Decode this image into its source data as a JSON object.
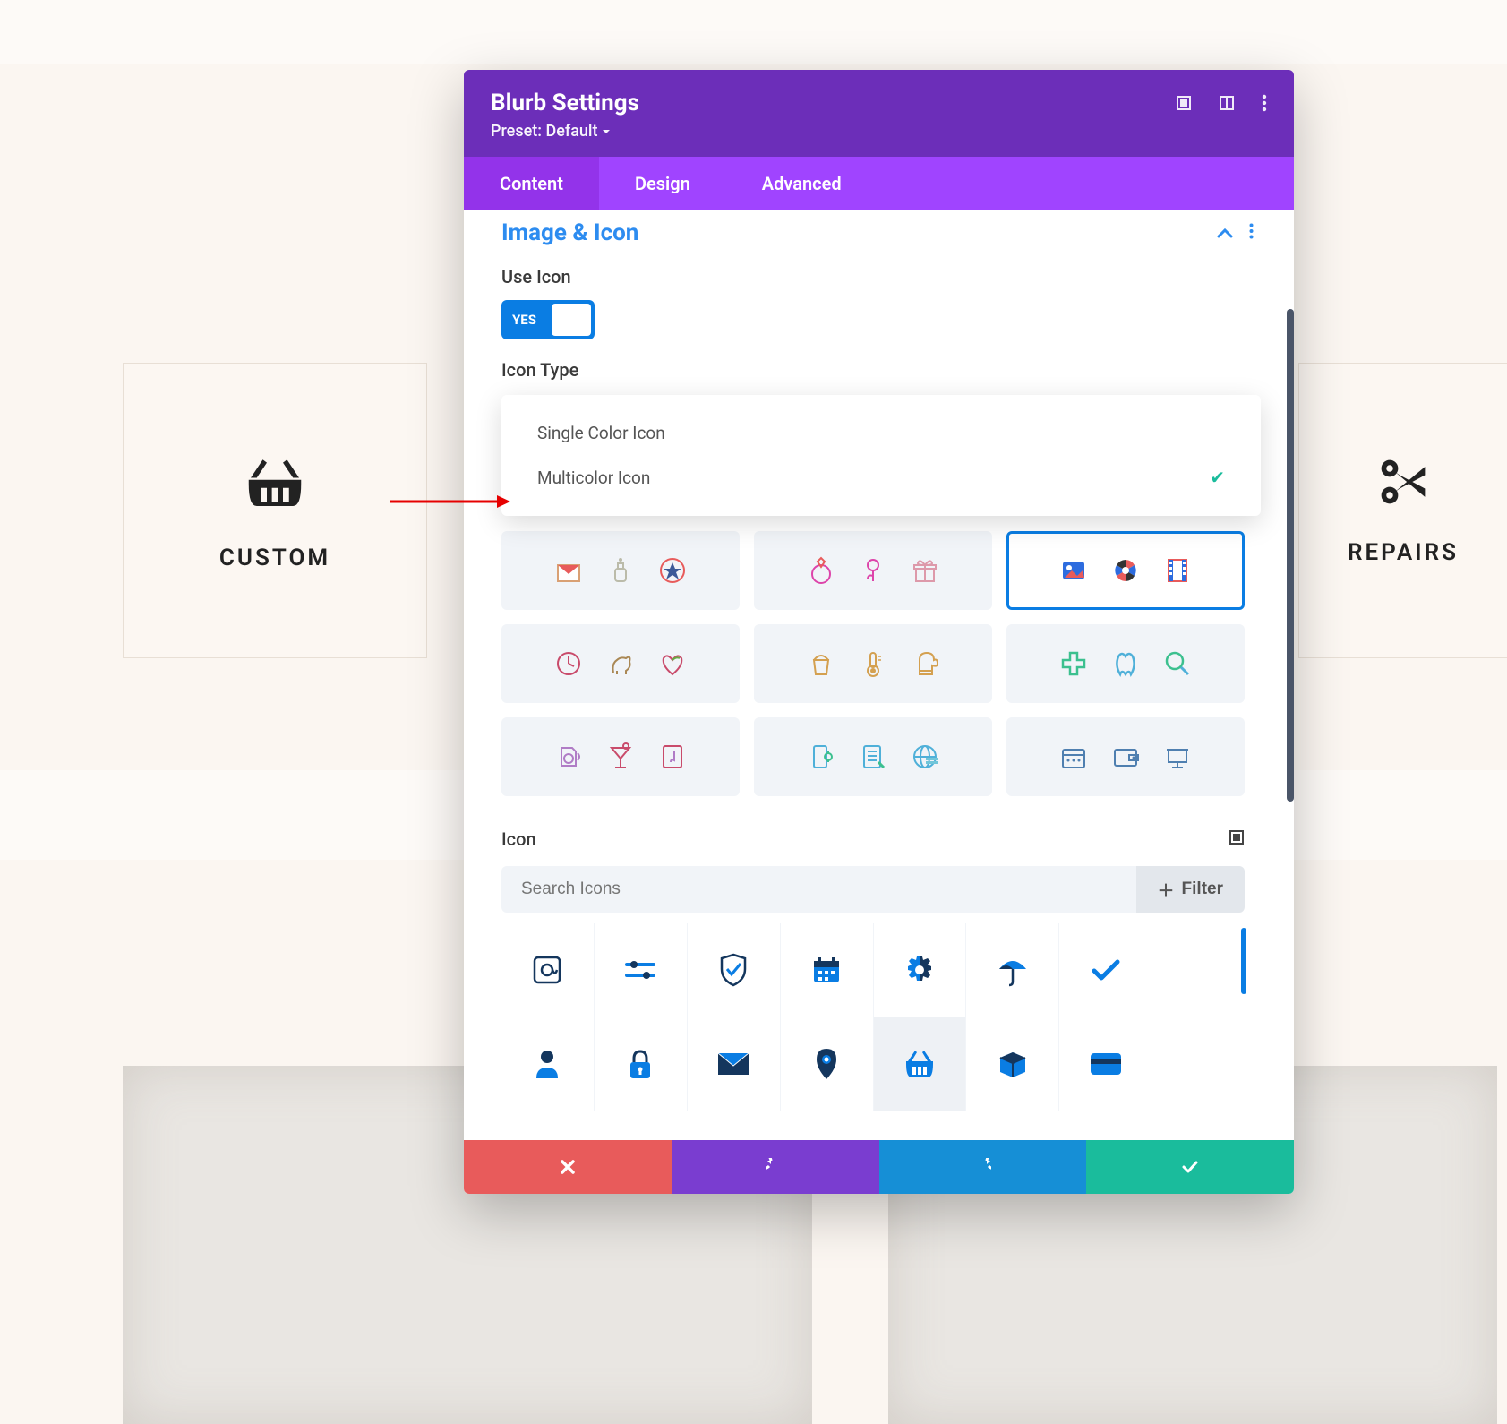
{
  "background": {
    "custom_label": "CUSTOM",
    "repairs_label": "REPAIRS"
  },
  "modal": {
    "title": "Blurb Settings",
    "preset_label": "Preset: Default",
    "tabs": {
      "content": "Content",
      "design": "Design",
      "advanced": "Advanced"
    },
    "section_title": "Image & Icon",
    "use_icon_label": "Use Icon",
    "use_icon_toggle": "YES",
    "icon_type_label": "Icon Type",
    "icon_type_options": {
      "single": "Single Color Icon",
      "multi": "Multicolor Icon"
    },
    "icon_type_selected": "Multicolor Icon",
    "icon_label": "Icon",
    "search_placeholder": "Search Icons",
    "filter_label": "Filter",
    "pack_names": {
      "r1c1": "gifts-celebration",
      "r1c2": "jewelry-gifts",
      "r1c3": "media-photo",
      "r2c1": "pets-time",
      "r2c2": "kitchen-food",
      "r2c3": "health-medical",
      "r3c1": "music-audio",
      "r3c2": "devices-web",
      "r3c3": "tools-office"
    },
    "icons": {
      "r1": [
        "at-sign",
        "sliders",
        "shield-check",
        "calendar",
        "gear-split",
        "umbrella",
        "checkmark",
        "blank"
      ],
      "r2": [
        "person",
        "lock",
        "mail",
        "map-pin",
        "shopping-basket",
        "package-box",
        "credit-card",
        "blank"
      ]
    },
    "footer": {
      "cancel": "cancel",
      "undo": "undo",
      "redo": "redo",
      "save": "save"
    }
  }
}
